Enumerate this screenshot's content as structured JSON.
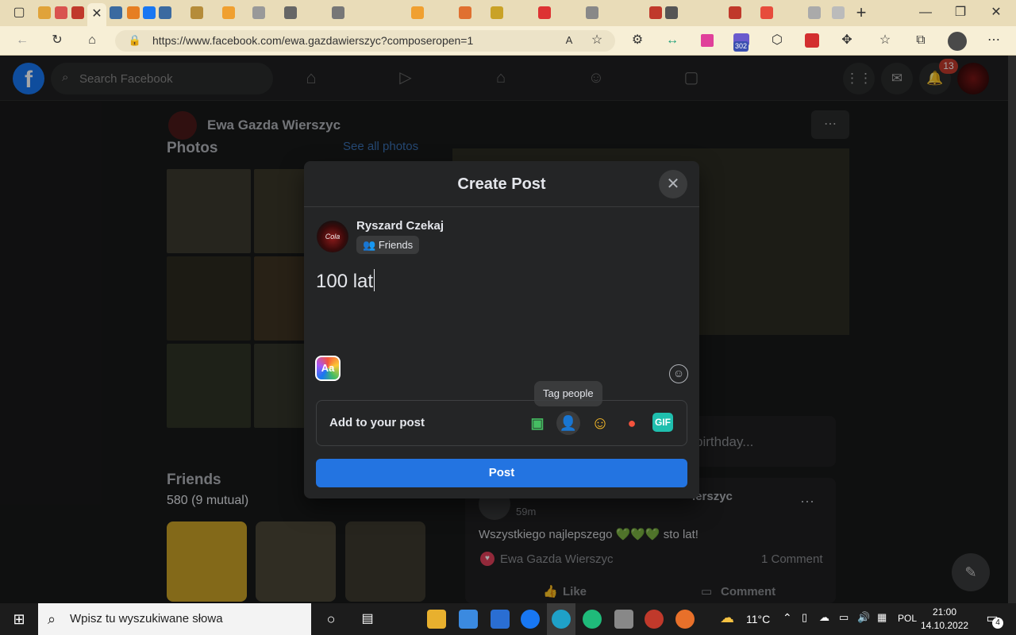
{
  "browser": {
    "url": "https://www.facebook.com/ewa.gazdawierszyc?composeropen=1",
    "badge_count": "302"
  },
  "fb_header": {
    "search_placeholder": "Search Facebook",
    "notifications_count": "13"
  },
  "profile": {
    "name": "Ewa Gazda Wierszyc",
    "photos_heading": "Photos",
    "see_all_photos": "See all photos",
    "friends_heading": "Friends",
    "friends_count": "580 (9 mutual)",
    "birthday_prompt": "birthday...",
    "post_author_suffix": "ierszyc",
    "post_time": "59m",
    "post_text": "Wszystkiego najlepszego 💚💚💚 sto lat!",
    "reaction_name": "Ewa Gazda Wierszyc",
    "comment_count": "1 Comment",
    "like_label": "Like",
    "comment_label": "Comment"
  },
  "composer": {
    "title": "Create Post",
    "user_name": "Ryszard Czekaj",
    "avatar_text": "Cola",
    "audience": "Friends",
    "post_text": "100 lat",
    "bg_button_label": "Aa",
    "add_to_post_label": "Add to your post",
    "tooltip": "Tag people",
    "gif_label": "GIF",
    "post_button": "Post"
  },
  "taskbar": {
    "search_placeholder": "Wpisz tu wyszukiwane słowa",
    "temperature": "11°C",
    "language": "POL",
    "time": "21:00",
    "date": "14.10.2022",
    "notifications": "4"
  }
}
